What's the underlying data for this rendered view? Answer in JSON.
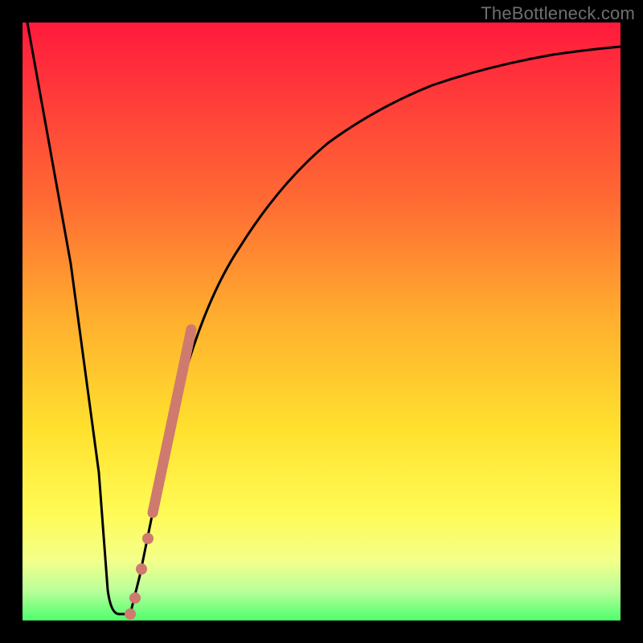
{
  "watermark": "TheBottleneck.com",
  "chart_data": {
    "type": "line",
    "title": "",
    "xlabel": "",
    "ylabel": "",
    "xlim": [
      0,
      100
    ],
    "ylim": [
      0,
      100
    ],
    "grid": false,
    "series": [
      {
        "name": "bottleneck-curve",
        "color": "#000000",
        "x": [
          0,
          2,
          4,
          6,
          8,
          10,
          11,
          12,
          14,
          16,
          18,
          20,
          22,
          25,
          28,
          32,
          36,
          40,
          45,
          50,
          55,
          60,
          65,
          70,
          75,
          80,
          85,
          90,
          95,
          100
        ],
        "y": [
          99,
          88,
          76,
          64,
          52,
          40,
          28,
          10,
          1,
          1,
          7,
          16,
          27,
          40,
          50,
          60,
          67,
          73,
          79,
          83,
          86,
          89,
          91,
          92.5,
          94,
          95,
          95.8,
          96.4,
          96.8,
          97
        ]
      },
      {
        "name": "highlight-points",
        "color": "#cf7a6e",
        "type": "scatter",
        "x": [
          17.0,
          17.8,
          18.7,
          20.0,
          21.0,
          22.0,
          22.8,
          23.5,
          24.2,
          25.0,
          25.7,
          26.3,
          26.8,
          27.3
        ],
        "y": [
          2.0,
          6.0,
          10.0,
          17.0,
          23.0,
          28.0,
          32.0,
          35.5,
          38.5,
          41.0,
          43.5,
          45.5,
          47.0,
          48.5
        ]
      }
    ],
    "annotations": []
  }
}
